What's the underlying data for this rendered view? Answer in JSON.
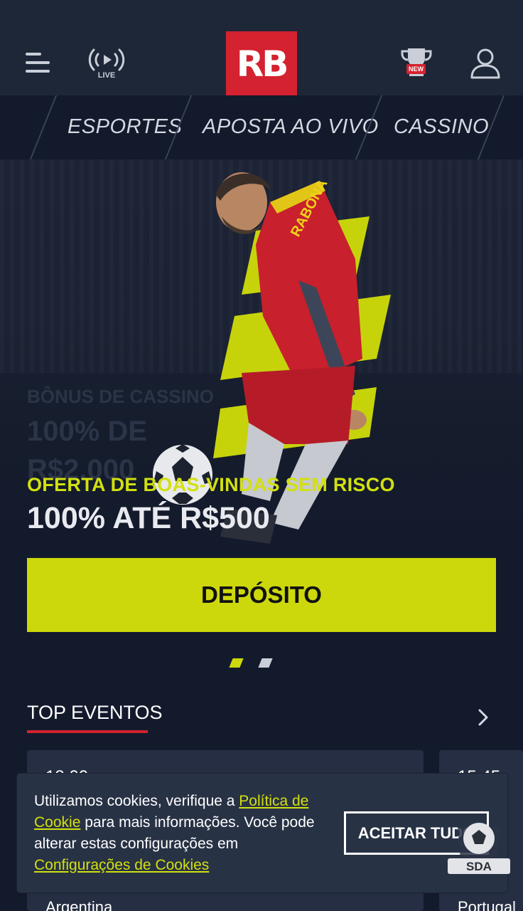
{
  "header": {
    "live_label": "LIVE",
    "logo": "RB",
    "new_badge": "NEW"
  },
  "nav": {
    "tabs": [
      "ESPORTES",
      "APOSTA AO VIVO",
      "CASSINO"
    ]
  },
  "hero": {
    "ghost_line1": "BÔNUS DE CASSINO",
    "ghost_line2": "100% DE",
    "ghost_line3": "R$2.000",
    "jersey_text": "RABONA",
    "subtitle": "OFERTA DE BOAS-VINDAS SEM RISCO",
    "title": "100% ATÉ R$500",
    "deposit_label": "DEPÓSITO",
    "slide_dots": [
      {
        "active": true,
        "color": "#cdd80c"
      },
      {
        "active": false,
        "color": "#c9ced8"
      }
    ]
  },
  "top_events": {
    "title": "TOP EVENTOS",
    "cards": [
      {
        "time": "18:00",
        "team": "Argentina"
      },
      {
        "time": "15:45",
        "team": "Portugal"
      }
    ]
  },
  "cookie": {
    "text_1": "Utilizamos cookies, verifique a ",
    "link_1": "Política de Cookie",
    "text_2": " para mais informações. Você pode alterar estas configurações em ",
    "link_2": "Configurações de Cookies",
    "accept_label": "ACEITAR TUDO"
  },
  "watermark": {
    "text": "SDA"
  },
  "colors": {
    "brand_red": "#d42230",
    "accent_yellow": "#cdd80c",
    "background": "#131a2c",
    "header_bg": "#1e2738"
  }
}
